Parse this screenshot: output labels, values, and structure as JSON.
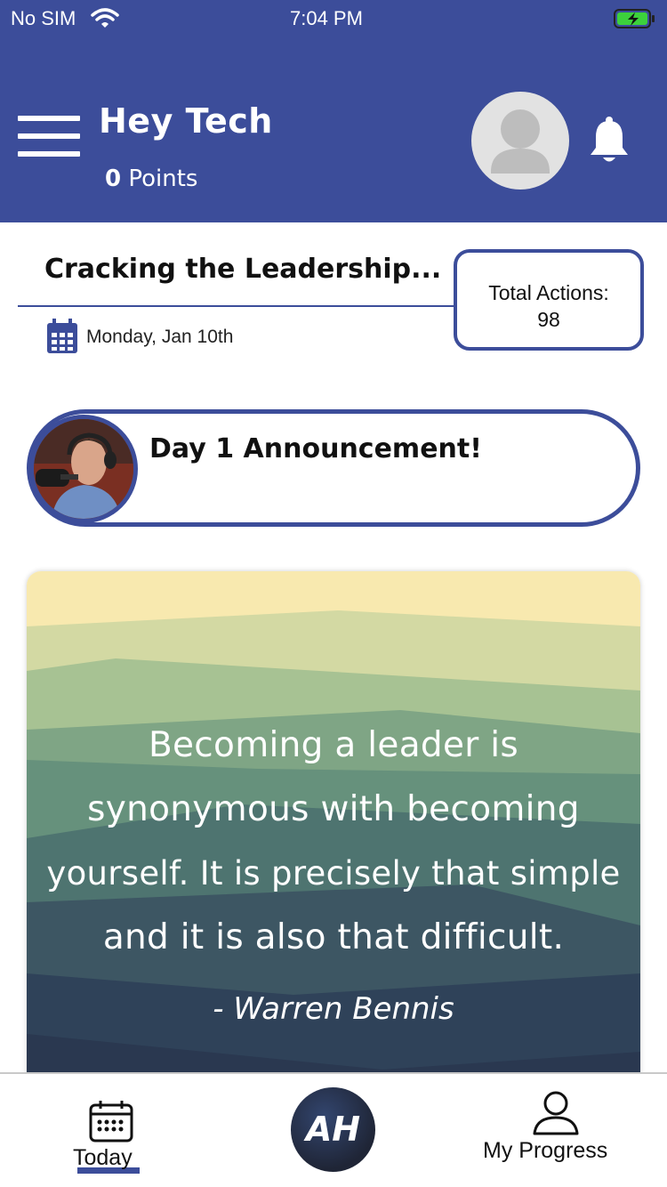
{
  "status_bar": {
    "carrier": "No SIM",
    "time": "7:04 PM"
  },
  "header": {
    "greeting": "Hey Tech",
    "points_value": "0",
    "points_label": "Points",
    "background_color": "#3C4D9A"
  },
  "course": {
    "title": "Cracking the Leadership...",
    "date": "Monday, Jan 10th",
    "total_actions_label": "Total Actions:",
    "total_actions_value": "98"
  },
  "announcement": {
    "title": "Day 1 Announcement!"
  },
  "quote": {
    "line1": "Becoming a leader is",
    "line2": "synonymous with becoming",
    "line3": "yourself. It is precisely that simple",
    "line4": "and it is also that difficult.",
    "author": "- Warren Bennis"
  },
  "tabbar": {
    "today_label": "Today",
    "center_logo": "AH",
    "progress_label": "My Progress"
  },
  "icons": [
    "wifi-icon",
    "battery-icon",
    "menu-icon",
    "avatar-icon",
    "bell-icon",
    "calendar-icon",
    "person-icon"
  ]
}
